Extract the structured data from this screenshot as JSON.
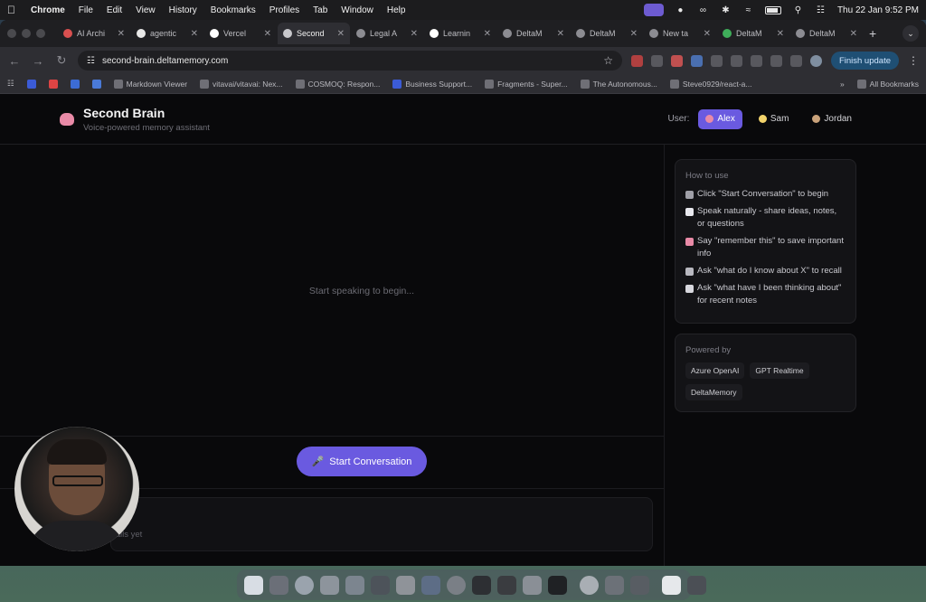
{
  "menubar": {
    "app": "Chrome",
    "items": [
      "File",
      "Edit",
      "View",
      "History",
      "Bookmarks",
      "Profiles",
      "Tab",
      "Window",
      "Help"
    ],
    "datetime": "Thu 22 Jan  9:52 PM"
  },
  "tabs": [
    {
      "title": "AI Archi",
      "active": false
    },
    {
      "title": "agentic",
      "active": false
    },
    {
      "title": "Vercel",
      "active": false
    },
    {
      "title": "Second",
      "active": true
    },
    {
      "title": "Legal A",
      "active": false
    },
    {
      "title": "Learnin",
      "active": false
    },
    {
      "title": "DeltaM",
      "active": false
    },
    {
      "title": "DeltaM",
      "active": false
    },
    {
      "title": "New ta",
      "active": false
    },
    {
      "title": "DeltaM",
      "active": false
    },
    {
      "title": "DeltaM",
      "active": false
    }
  ],
  "toolbar": {
    "url": "second-brain.deltamemory.com",
    "finish_update": "Finish update"
  },
  "bookmarks": [
    "Markdown Viewer",
    "vitavai/vitavai: Nex...",
    "COSMOQ: Respon...",
    "Business Support...",
    "Fragments - Super...",
    "The Autonomous...",
    "Steve0929/react-a..."
  ],
  "all_bookmarks": "All Bookmarks",
  "app": {
    "title": "Second Brain",
    "subtitle": "Voice-powered memory assistant",
    "user_label": "User:",
    "users": [
      {
        "name": "Alex",
        "active": true,
        "icon_color": "#e98aa7"
      },
      {
        "name": "Sam",
        "active": false,
        "icon_color": "#f2d36b"
      },
      {
        "name": "Jordan",
        "active": false,
        "icon_color": "#c9a27a"
      }
    ],
    "placeholder": "Start speaking to begin...",
    "start_button": "Start Conversation",
    "calls_empty": "calls yet"
  },
  "how_to": {
    "title": "How to use",
    "items": [
      "Click \"Start Conversation\" to begin",
      "Speak naturally - share ideas, notes, or questions",
      "Say \"remember this\" to save important info",
      "Ask \"what do I know about X\" to recall",
      "Ask \"what have I been thinking about\" for recent notes"
    ]
  },
  "powered_by": {
    "title": "Powered by",
    "tags": [
      "Azure OpenAI",
      "GPT Realtime",
      "DeltaMemory"
    ]
  },
  "colors": {
    "accent": "#6a5ae0",
    "page_bg": "#09090b",
    "card_bg": "#131316"
  }
}
